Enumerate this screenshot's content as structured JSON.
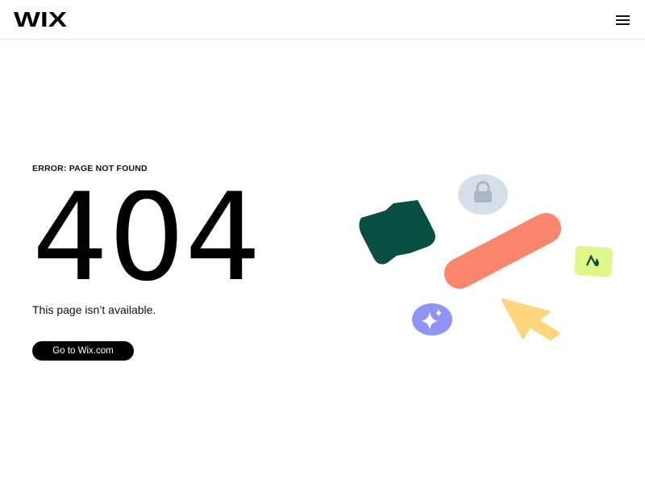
{
  "header": {
    "logo_text": "WIX",
    "menu_icon": "hamburger-menu-icon"
  },
  "main": {
    "error_label": "ERROR: PAGE NOT FOUND",
    "error_code": "404",
    "message": "This page isn’t available.",
    "cta_label": "Go to Wix.com"
  },
  "illustration": {
    "icons": [
      "lock-icon",
      "sparkle-icon",
      "cursor-arrow-icon",
      "mountain-image-icon",
      "puzzle-blob-shape"
    ],
    "colors": {
      "dark_green": "#0a4d42",
      "salmon": "#f9866c",
      "lock_bubble": "#d5dfea",
      "lock": "#a6b5c8",
      "sparkle_bubble": "#8f95f4",
      "cursor": "#fdd67d",
      "image_tile": "#dff78a",
      "image_glyph": "#0a4d42"
    }
  }
}
